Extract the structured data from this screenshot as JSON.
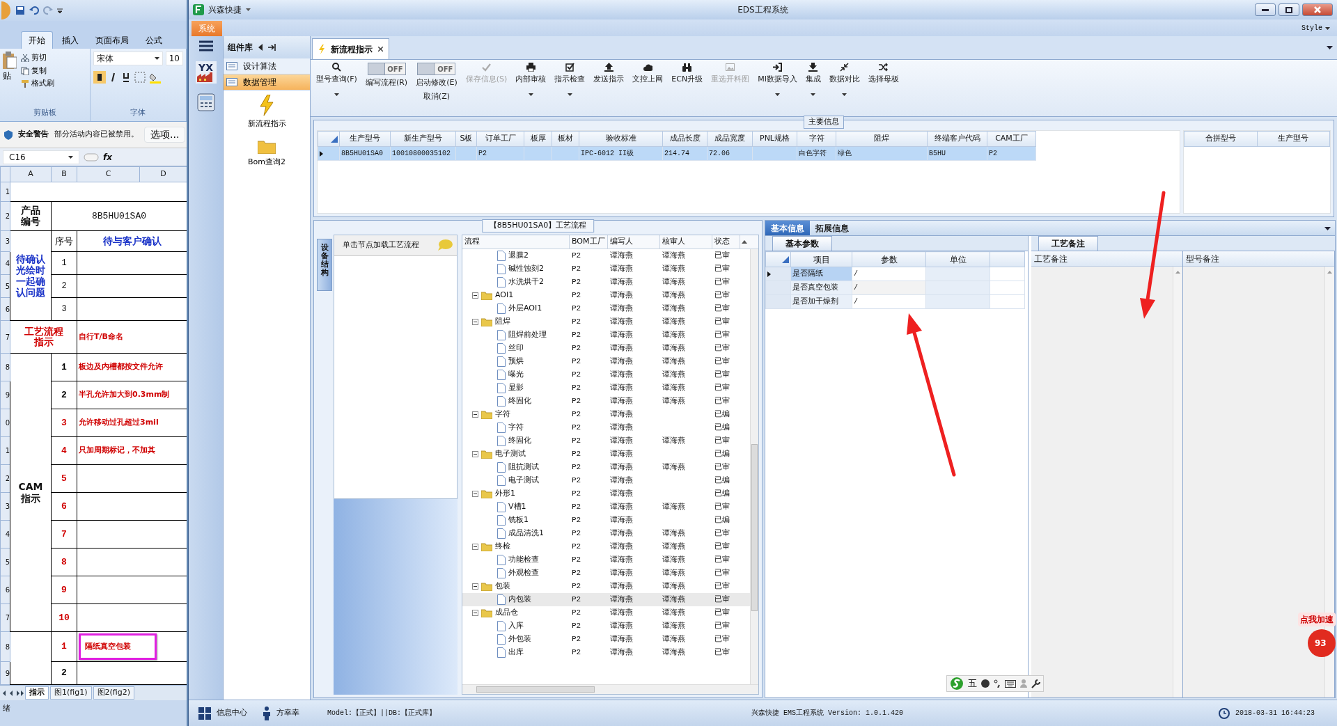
{
  "excel": {
    "ribbon_tabs": [
      {
        "label": "开始",
        "selected": true
      },
      {
        "label": "插入",
        "selected": false
      },
      {
        "label": "页面布局",
        "selected": false
      },
      {
        "label": "公式",
        "selected": false
      }
    ],
    "clipboard": {
      "paste": "贴",
      "cut": "剪切",
      "copy": "复制",
      "format_painter": "格式刷",
      "group": "剪贴板"
    },
    "font": {
      "name": "宋体",
      "size": "10",
      "group": "字体"
    },
    "security": {
      "title": "安全警告",
      "message": "部分活动内容已被禁用。",
      "button": "选项..."
    },
    "name_box": "C16",
    "function_label": "fx",
    "columns": [
      "A",
      "B",
      "C",
      "D"
    ],
    "row_numbers": [
      "1",
      "2",
      "3",
      "4",
      "5",
      "6",
      "7",
      "8",
      "9",
      "0",
      "1",
      "2",
      "3",
      "4",
      "5",
      "6",
      "7",
      "8",
      "9"
    ],
    "product_label": "产品编号",
    "product_code": "8B5HU01SA0",
    "confirm": {
      "label": "待确认光绘时一起确认问题",
      "seq_header": "序号",
      "header": "待与客户确认",
      "items": [
        "1",
        "2",
        "3"
      ]
    },
    "process": {
      "label": "工艺流程指示",
      "text": "自行T/B命名"
    },
    "cam": {
      "label": "CAM指示",
      "items": [
        {
          "no": "1",
          "color": "#000000",
          "text": "板边及内槽都按文件允许"
        },
        {
          "no": "2",
          "color": "#000000",
          "text": "半孔允许加大到0.3mm制"
        },
        {
          "no": "3",
          "color": "#d00000",
          "text": "允许移动过孔超过3mil"
        },
        {
          "no": "4",
          "color": "#d00000",
          "text": "只加周期标记，不加其"
        },
        {
          "no": "5",
          "color": "#d00000"
        },
        {
          "no": "6",
          "color": "#d00000"
        },
        {
          "no": "7",
          "color": "#d00000"
        },
        {
          "no": "8",
          "color": "#d00000"
        },
        {
          "no": "9",
          "color": "#d00000"
        },
        {
          "no": "10",
          "color": "#d00000"
        }
      ]
    },
    "packing": [
      {
        "no": "1",
        "color": "#d00000",
        "text": "隔纸真空包装",
        "highlighted": true
      },
      {
        "no": "2",
        "color": "#000000"
      }
    ],
    "sheet_tabs": [
      {
        "label": "指示",
        "selected": true
      },
      {
        "label": "图1(fig1)",
        "selected": false
      },
      {
        "label": "图2(fig2)",
        "selected": false
      }
    ],
    "status": "绪"
  },
  "window": {
    "app_name": "兴森快捷",
    "title": "EDS工程系统",
    "style_label": "Style"
  },
  "menu_tabs": [
    {
      "label": "系统",
      "selected": true
    }
  ],
  "nav": {
    "logo_text": "YX"
  },
  "component_library": {
    "title": "组件库",
    "items": [
      {
        "label": "设计算法",
        "selected": false
      },
      {
        "label": "数据管理",
        "selected": true
      }
    ],
    "tools": [
      {
        "label": "新流程指示",
        "kind": "lightning"
      },
      {
        "label": "Bom查询2",
        "kind": "folder"
      }
    ]
  },
  "doc_tabs": [
    {
      "label": "新流程指示",
      "selected": true
    }
  ],
  "toolbar": [
    {
      "kind": "button",
      "label": "型号查询(F)",
      "dropdown": true,
      "disabled": false
    },
    {
      "kind": "toggle",
      "label": "编写流程(R)",
      "toggle_text": "OFF",
      "on": false
    },
    {
      "kind": "toggle",
      "label": "启动修改(E)",
      "sublabel": "取消(Z)",
      "toggle_text": "OFF",
      "on": false
    },
    {
      "kind": "button",
      "label": "保存信息(S)",
      "dropdown": false,
      "disabled": true
    },
    {
      "kind": "button",
      "label": "内部审核",
      "dropdown": true,
      "disabled": false
    },
    {
      "kind": "button",
      "label": "指示检查",
      "dropdown": true,
      "disabled": false
    },
    {
      "kind": "button",
      "label": "发送指示",
      "dropdown": false,
      "disabled": false
    },
    {
      "kind": "button",
      "label": "文控上网",
      "dropdown": false,
      "disabled": false
    },
    {
      "kind": "button",
      "label": "ECN升级",
      "dropdown": false,
      "disabled": false
    },
    {
      "kind": "button",
      "label": "重选开料图",
      "dropdown": false,
      "disabled": true
    },
    {
      "kind": "button",
      "label": "MI数据导入",
      "dropdown": true,
      "disabled": false
    },
    {
      "kind": "button",
      "label": "集成",
      "dropdown": true,
      "disabled": false
    },
    {
      "kind": "button",
      "label": "数据对比",
      "dropdown": true,
      "disabled": false
    },
    {
      "kind": "button",
      "label": "选择母板",
      "dropdown": false,
      "disabled": false
    }
  ],
  "main_info": {
    "title": "主要信息",
    "columns": [
      "生产型号",
      "新生产型号",
      "S板",
      "订单工厂",
      "板厚",
      "板材",
      "验收标准",
      "成品长度",
      "成品宽度",
      "PNL规格",
      "字符",
      "阻焊",
      "终端客户代码",
      "CAM工厂"
    ],
    "rows": [
      {
        "selected": true,
        "cells": [
          "8B5HU01SA0",
          "10010800035102",
          null,
          "P2",
          null,
          null,
          "IPC-6012 II级",
          "214.74",
          "72.06",
          null,
          "白色字符",
          "绿色",
          "B5HU",
          "P2"
        ]
      }
    ],
    "side_columns": [
      "合拼型号",
      "生产型号"
    ]
  },
  "process_panel": {
    "title": "【8B5HU01SA0】工艺流程",
    "side_tab": "设备结构",
    "hint": "单击节点加载工艺流程",
    "columns": [
      "流程",
      "BOM工厂",
      "编写人",
      "核审人",
      "状态"
    ],
    "continued": [
      {
        "label": "退膜2",
        "bom": "P2",
        "writer": "谭海燕",
        "reviewer": "谭海燕",
        "status": "已审",
        "selected": false
      },
      {
        "label": "碱性蚀刻2",
        "bom": "P2",
        "writer": "谭海燕",
        "reviewer": "谭海燕",
        "status": "已审",
        "selected": false
      },
      {
        "label": "水洗烘干2",
        "bom": "P2",
        "writer": "谭海燕",
        "reviewer": "谭海燕",
        "status": "已审",
        "selected": false
      }
    ],
    "nodes": [
      {
        "label": "AOI1",
        "bom": "P2",
        "writer": "谭海燕",
        "reviewer": "谭海燕",
        "status": "已审",
        "selected": false,
        "expanded": true,
        "children": [
          {
            "label": "外层AOI1",
            "bom": "P2",
            "writer": "谭海燕",
            "reviewer": "谭海燕",
            "status": "已审",
            "selected": false
          }
        ]
      },
      {
        "label": "阻焊",
        "bom": "P2",
        "writer": "谭海燕",
        "reviewer": "谭海燕",
        "status": "已审",
        "selected": false,
        "expanded": true,
        "children": [
          {
            "label": "阻焊前处理",
            "bom": "P2",
            "writer": "谭海燕",
            "reviewer": "谭海燕",
            "status": "已审",
            "selected": false
          },
          {
            "label": "丝印",
            "bom": "P2",
            "writer": "谭海燕",
            "reviewer": "谭海燕",
            "status": "已审",
            "selected": false
          },
          {
            "label": "预烘",
            "bom": "P2",
            "writer": "谭海燕",
            "reviewer": "谭海燕",
            "status": "已审",
            "selected": false
          },
          {
            "label": "曝光",
            "bom": "P2",
            "writer": "谭海燕",
            "reviewer": "谭海燕",
            "status": "已审",
            "selected": false
          },
          {
            "label": "显影",
            "bom": "P2",
            "writer": "谭海燕",
            "reviewer": "谭海燕",
            "status": "已审",
            "selected": false
          },
          {
            "label": "终固化",
            "bom": "P2",
            "writer": "谭海燕",
            "reviewer": "谭海燕",
            "status": "已审",
            "selected": false
          }
        ]
      },
      {
        "label": "字符",
        "bom": "P2",
        "writer": "谭海燕",
        "status": "已编",
        "selected": false,
        "expanded": true,
        "children": [
          {
            "label": "字符",
            "bom": "P2",
            "writer": "谭海燕",
            "status": "已编",
            "selected": false
          },
          {
            "label": "终固化",
            "bom": "P2",
            "writer": "谭海燕",
            "reviewer": "谭海燕",
            "status": "已审",
            "selected": false
          }
        ]
      },
      {
        "label": "电子测试",
        "bom": "P2",
        "writer": "谭海燕",
        "status": "已编",
        "selected": false,
        "expanded": true,
        "children": [
          {
            "label": "阻抗测试",
            "bom": "P2",
            "writer": "谭海燕",
            "reviewer": "谭海燕",
            "status": "已审",
            "selected": false
          },
          {
            "label": "电子测试",
            "bom": "P2",
            "writer": "谭海燕",
            "status": "已编",
            "selected": false
          }
        ]
      },
      {
        "label": "外形1",
        "bom": "P2",
        "writer": "谭海燕",
        "status": "已编",
        "selected": false,
        "expanded": true,
        "children": [
          {
            "label": "V槽1",
            "bom": "P2",
            "writer": "谭海燕",
            "reviewer": "谭海燕",
            "status": "已审",
            "selected": false
          },
          {
            "label": "铣板1",
            "bom": "P2",
            "writer": "谭海燕",
            "status": "已编",
            "selected": false
          },
          {
            "label": "成品清洗1",
            "bom": "P2",
            "writer": "谭海燕",
            "reviewer": "谭海燕",
            "status": "已审",
            "selected": false
          }
        ]
      },
      {
        "label": "终检",
        "bom": "P2",
        "writer": "谭海燕",
        "reviewer": "谭海燕",
        "status": "已审",
        "selected": false,
        "expanded": true,
        "children": [
          {
            "label": "功能检查",
            "bom": "P2",
            "writer": "谭海燕",
            "reviewer": "谭海燕",
            "status": "已审",
            "selected": false
          },
          {
            "label": "外观检查",
            "bom": "P2",
            "writer": "谭海燕",
            "reviewer": "谭海燕",
            "status": "已审",
            "selected": false
          }
        ]
      },
      {
        "label": "包装",
        "bom": "P2",
        "writer": "谭海燕",
        "reviewer": "谭海燕",
        "status": "已审",
        "selected": false,
        "expanded": true,
        "children": [
          {
            "label": "内包装",
            "bom": "P2",
            "writer": "谭海燕",
            "reviewer": "谭海燕",
            "status": "已审",
            "selected": true
          }
        ]
      },
      {
        "label": "成品仓",
        "bom": "P2",
        "writer": "谭海燕",
        "reviewer": "谭海燕",
        "status": "已审",
        "selected": false,
        "expanded": true,
        "children": [
          {
            "label": "入库",
            "bom": "P2",
            "writer": "谭海燕",
            "reviewer": "谭海燕",
            "status": "已审",
            "selected": false
          },
          {
            "label": "外包装",
            "bom": "P2",
            "writer": "谭海燕",
            "reviewer": "谭海燕",
            "status": "已审",
            "selected": false
          },
          {
            "label": "出库",
            "bom": "P2",
            "writer": "谭海燕",
            "reviewer": "谭海燕",
            "status": "已审",
            "selected": false
          }
        ]
      }
    ]
  },
  "info_tabs": [
    {
      "label": "基本信息",
      "selected": true
    },
    {
      "label": "拓展信息",
      "selected": false
    }
  ],
  "basic_params": {
    "tab": "基本参数",
    "columns": [
      "项目",
      "参数",
      "单位"
    ],
    "rows": [
      {
        "item": "是否隔纸",
        "value": "/",
        "selected": true
      },
      {
        "item": "是否真空包装",
        "value": "/",
        "selected": false
      },
      {
        "item": "是否加干燥剂",
        "value": "/",
        "selected": false
      }
    ]
  },
  "notes": {
    "tab": "工艺备注",
    "columns": [
      "工艺备注",
      "型号备注"
    ]
  },
  "ime": {
    "mode": "五"
  },
  "accelerator": {
    "label": "点我加速",
    "count": "93"
  },
  "status_bar": {
    "info": "信息中心",
    "user": "方幸幸",
    "model": "Model:【正式】||DB:【正式库】",
    "app": "兴森快捷 EMS工程系统 Version: 1.0.1.420",
    "time": "2018-03-31 16:44:23"
  }
}
